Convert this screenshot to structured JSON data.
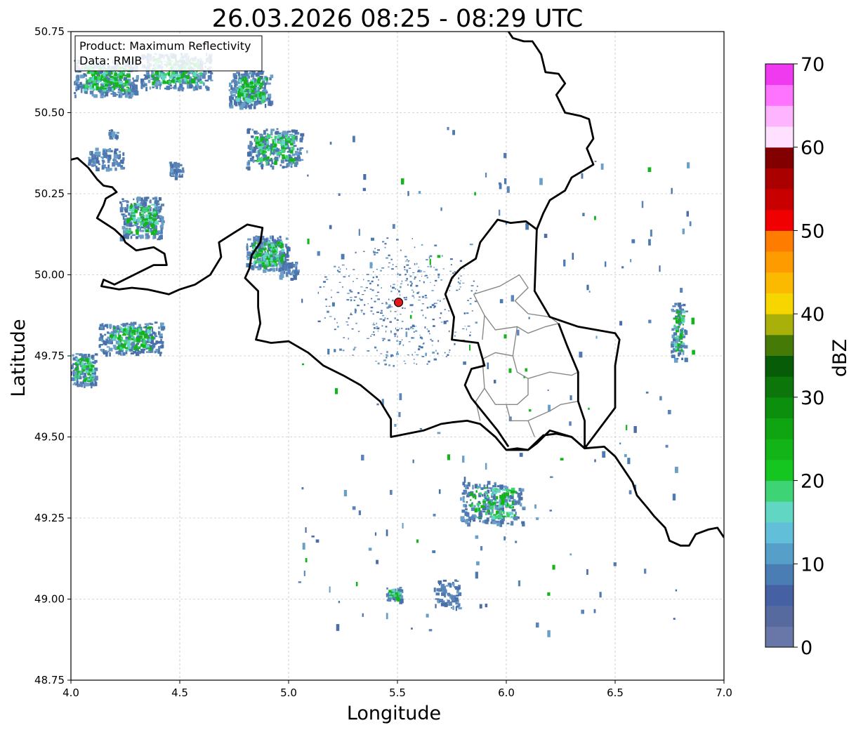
{
  "title": "26.03.2026 08:25 - 08:29 UTC",
  "info_box": {
    "product": "Product: Maximum Reflectivity",
    "data_source": "Data: RMIB"
  },
  "x_axis": {
    "label": "Longitude",
    "range": [
      4.0,
      7.0
    ],
    "ticks": [
      "4.0",
      "4.5",
      "5.0",
      "5.5",
      "6.0",
      "6.5",
      "7.0"
    ]
  },
  "y_axis": {
    "label": "Latitude",
    "range": [
      48.75,
      50.75
    ],
    "ticks": [
      "48.75",
      "49.00",
      "49.25",
      "49.50",
      "49.75",
      "50.00",
      "50.25",
      "50.50",
      "50.75"
    ]
  },
  "grid": true,
  "colorbar": {
    "label": "dBZ",
    "range": [
      0,
      70
    ],
    "ticks": [
      "0",
      "10",
      "20",
      "30",
      "40",
      "50",
      "60",
      "70"
    ],
    "colors": [
      "#6877a8",
      "#566aa0",
      "#4561a4",
      "#4a7db4",
      "#559fc8",
      "#61bfda",
      "#61d6c3",
      "#3ed374",
      "#14c61f",
      "#12b418",
      "#0fa412",
      "#0d8f0e",
      "#0c760a",
      "#075c07",
      "#457a07",
      "#a8b009",
      "#f7d600",
      "#fbb900",
      "#fd9b00",
      "#fe7c00",
      "#f00000",
      "#c90000",
      "#ab0000",
      "#820000",
      "#ffe0ff",
      "#ffb4ff",
      "#ff74ff",
      "#f03af0"
    ]
  },
  "radar_site": {
    "lon": 5.505,
    "lat": 49.915,
    "color": "#e31a1c"
  },
  "boundaries": {
    "national": [
      [
        [
          4.0,
          50.355
        ],
        [
          4.03,
          50.36
        ],
        [
          4.08,
          50.33
        ],
        [
          4.12,
          50.295
        ],
        [
          4.15,
          50.275
        ],
        [
          4.19,
          50.27
        ],
        [
          4.21,
          50.255
        ],
        [
          4.16,
          50.235
        ],
        [
          4.15,
          50.215
        ],
        [
          4.12,
          50.175
        ],
        [
          4.2,
          50.14
        ],
        [
          4.24,
          50.115
        ],
        [
          4.25,
          50.1
        ],
        [
          4.3,
          50.075
        ],
        [
          4.38,
          50.085
        ],
        [
          4.43,
          50.065
        ],
        [
          4.44,
          50.03
        ],
        [
          4.38,
          50.03
        ],
        [
          4.2,
          49.97
        ],
        [
          4.15,
          49.985
        ],
        [
          4.14,
          49.965
        ],
        [
          4.22,
          49.955
        ],
        [
          4.28,
          49.96
        ],
        [
          4.35,
          49.955
        ],
        [
          4.45,
          49.94
        ],
        [
          4.5,
          49.955
        ],
        [
          4.57,
          49.97
        ],
        [
          4.64,
          50.0
        ],
        [
          4.69,
          50.055
        ],
        [
          4.68,
          50.1
        ],
        [
          4.75,
          50.13
        ],
        [
          4.81,
          50.155
        ],
        [
          4.88,
          50.145
        ],
        [
          4.87,
          50.1
        ],
        [
          4.83,
          50.06
        ],
        [
          4.82,
          50.02
        ],
        [
          4.8,
          49.99
        ],
        [
          4.86,
          49.95
        ],
        [
          4.86,
          49.9
        ],
        [
          4.87,
          49.85
        ],
        [
          4.85,
          49.8
        ],
        [
          4.92,
          49.79
        ],
        [
          5.0,
          49.795
        ],
        [
          5.09,
          49.76
        ],
        [
          5.16,
          49.72
        ],
        [
          5.25,
          49.69
        ],
        [
          5.33,
          49.66
        ],
        [
          5.42,
          49.61
        ],
        [
          5.47,
          49.555
        ],
        [
          5.47,
          49.5
        ],
        [
          5.62,
          49.52
        ],
        [
          5.7,
          49.54
        ],
        [
          5.75,
          49.545
        ],
        [
          5.82,
          49.55
        ],
        [
          5.88,
          49.54
        ],
        [
          5.95,
          49.5
        ],
        [
          6.0,
          49.46
        ],
        [
          6.1,
          49.46
        ],
        [
          6.17,
          49.505
        ],
        [
          6.23,
          49.51
        ],
        [
          6.3,
          49.5
        ],
        [
          6.36,
          49.465
        ],
        [
          6.45,
          49.47
        ],
        [
          6.5,
          49.44
        ],
        [
          6.55,
          49.39
        ],
        [
          6.58,
          49.36
        ],
        [
          6.6,
          49.32
        ],
        [
          6.65,
          49.28
        ],
        [
          6.68,
          49.255
        ],
        [
          6.73,
          49.22
        ],
        [
          6.75,
          49.18
        ],
        [
          6.8,
          49.165
        ],
        [
          6.84,
          49.165
        ],
        [
          6.87,
          49.2
        ],
        [
          6.93,
          49.215
        ],
        [
          6.97,
          49.22
        ],
        [
          7.0,
          49.19
        ]
      ],
      [
        [
          6.01,
          50.75
        ],
        [
          6.03,
          50.73
        ],
        [
          6.08,
          50.72
        ],
        [
          6.12,
          50.72
        ],
        [
          6.16,
          50.68
        ],
        [
          6.18,
          50.625
        ],
        [
          6.24,
          50.62
        ],
        [
          6.27,
          50.59
        ],
        [
          6.23,
          50.555
        ],
        [
          6.27,
          50.5
        ],
        [
          6.34,
          50.49
        ],
        [
          6.38,
          50.48
        ],
        [
          6.4,
          50.42
        ],
        [
          6.37,
          50.39
        ],
        [
          6.4,
          50.34
        ],
        [
          6.35,
          50.32
        ],
        [
          6.3,
          50.3
        ],
        [
          6.27,
          50.26
        ],
        [
          6.2,
          50.23
        ],
        [
          6.17,
          50.19
        ],
        [
          6.14,
          50.14
        ],
        [
          6.09,
          50.165
        ],
        [
          6.02,
          50.16
        ],
        [
          5.96,
          50.17
        ],
        [
          5.88,
          50.1
        ],
        [
          5.86,
          50.05
        ],
        [
          5.79,
          50.02
        ],
        [
          5.75,
          49.99
        ],
        [
          5.72,
          49.94
        ],
        [
          5.76,
          49.87
        ],
        [
          5.75,
          49.8
        ],
        [
          5.87,
          49.79
        ],
        [
          5.9,
          49.72
        ],
        [
          5.84,
          49.71
        ],
        [
          5.81,
          49.66
        ],
        [
          5.84,
          49.62
        ],
        [
          5.9,
          49.57
        ],
        [
          5.96,
          49.52
        ],
        [
          6.01,
          49.47
        ]
      ],
      [
        [
          6.0,
          49.46
        ],
        [
          6.05,
          49.465
        ],
        [
          6.1,
          49.46
        ],
        [
          6.14,
          49.48
        ],
        [
          6.2,
          49.52
        ],
        [
          6.3,
          49.5
        ],
        [
          6.36,
          49.465
        ],
        [
          6.5,
          49.59
        ],
        [
          6.5,
          49.72
        ],
        [
          6.52,
          49.8
        ],
        [
          6.5,
          49.82
        ],
        [
          6.33,
          49.84
        ],
        [
          6.2,
          49.87
        ],
        [
          6.13,
          49.95
        ],
        [
          6.14,
          50.14
        ]
      ],
      [
        [
          6.36,
          49.465
        ],
        [
          6.36,
          49.55
        ],
        [
          6.33,
          49.61
        ],
        [
          6.33,
          49.7
        ],
        [
          6.28,
          49.78
        ],
        [
          6.24,
          49.85
        ]
      ]
    ],
    "regional": [
      [
        [
          5.85,
          49.94
        ],
        [
          5.97,
          49.965
        ],
        [
          6.06,
          50.0
        ],
        [
          6.1,
          49.96
        ],
        [
          6.04,
          49.92
        ],
        [
          6.1,
          49.88
        ],
        [
          6.2,
          49.87
        ],
        [
          6.24,
          49.85
        ]
      ],
      [
        [
          5.85,
          49.94
        ],
        [
          5.9,
          49.875
        ],
        [
          5.95,
          49.83
        ],
        [
          6.05,
          49.84
        ],
        [
          6.1,
          49.82
        ],
        [
          6.18,
          49.84
        ],
        [
          6.24,
          49.85
        ]
      ],
      [
        [
          5.9,
          49.875
        ],
        [
          5.89,
          49.8
        ]
      ],
      [
        [
          6.05,
          49.84
        ],
        [
          6.03,
          49.75
        ],
        [
          6.05,
          49.7
        ],
        [
          6.1,
          49.68
        ]
      ],
      [
        [
          5.89,
          49.74
        ],
        [
          5.95,
          49.76
        ],
        [
          6.03,
          49.75
        ]
      ],
      [
        [
          5.89,
          49.74
        ],
        [
          5.9,
          49.65
        ],
        [
          5.95,
          49.6
        ],
        [
          6.0,
          49.6
        ],
        [
          6.05,
          49.6
        ],
        [
          6.1,
          49.63
        ],
        [
          6.1,
          49.68
        ]
      ],
      [
        [
          6.1,
          49.68
        ],
        [
          6.2,
          49.7
        ],
        [
          6.3,
          49.69
        ],
        [
          6.33,
          49.7
        ]
      ],
      [
        [
          5.9,
          49.65
        ],
        [
          5.86,
          49.61
        ],
        [
          5.88,
          49.55
        ]
      ],
      [
        [
          6.0,
          49.6
        ],
        [
          6.02,
          49.55
        ],
        [
          6.1,
          49.55
        ],
        [
          6.2,
          49.58
        ],
        [
          6.25,
          49.6
        ],
        [
          6.33,
          49.61
        ]
      ],
      [
        [
          6.1,
          49.55
        ],
        [
          6.13,
          49.5
        ]
      ]
    ]
  }
}
